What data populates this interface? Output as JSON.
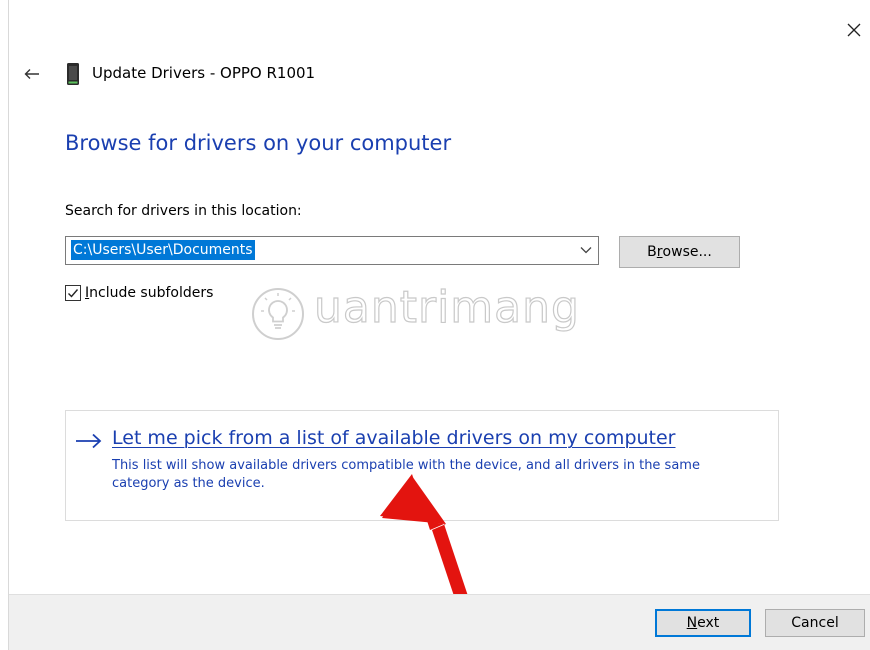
{
  "window": {
    "title": "Update Drivers - OPPO R1001"
  },
  "page": {
    "heading": "Browse for drivers on your computer",
    "search_label": "Search for drivers in this location:",
    "location": {
      "value": "C:\\Users\\User\\Documents"
    },
    "browse_button": {
      "accesskey": "r",
      "before": "B",
      "after": "owse..."
    },
    "include_subfolders": {
      "checked": true,
      "accesskey": "I",
      "after": "nclude subfolders"
    }
  },
  "watermark": {
    "text": "uantrimang"
  },
  "pick_option": {
    "title": "Let me pick from a list of available drivers on my computer",
    "description": "This list will show available drivers compatible with the device, and all drivers in the same category as the device."
  },
  "footer": {
    "next_button": {
      "accesskey": "N",
      "after": "ext"
    },
    "cancel_button": {
      "label": "Cancel"
    }
  },
  "icons": {
    "close": "close-icon",
    "back": "back-arrow-icon",
    "device": "phone-icon",
    "chevron": "chevron-down-icon",
    "check": "checkmark-icon",
    "option_arrow": "right-arrow-icon",
    "annotation": "red-pointer-arrow",
    "watermark_logo": "lightbulb-icon"
  },
  "colors": {
    "link_blue": "#1a3fb0",
    "selection_blue": "#0078d7",
    "annotation_red": "#e3140f"
  }
}
